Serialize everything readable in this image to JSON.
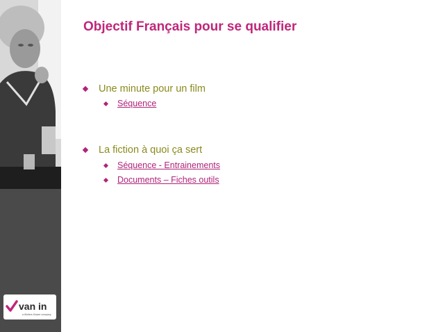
{
  "slide": {
    "title": "Objectif Français pour se qualifier"
  },
  "sections": [
    {
      "heading": "Une minute pour un film",
      "links": [
        "Séquence"
      ]
    },
    {
      "heading": "La fiction à quoi ça sert",
      "links": [
        "Séquence - Entrainements",
        "Documents – Fiches outils"
      ]
    }
  ],
  "colors": {
    "title": "#c0267a",
    "heading": "#8a8a1e",
    "link": "#b0237a",
    "sidebar": "#4a4a4a"
  },
  "logo": {
    "name": "van in",
    "tagline": "a Wolters Kluwer company",
    "icon": "checkmark-icon"
  },
  "photo": {
    "subject": "boy-in-class-photo"
  }
}
